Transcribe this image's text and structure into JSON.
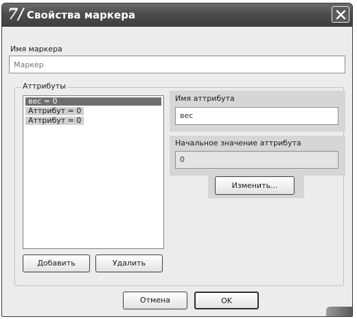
{
  "window": {
    "logo": "7/",
    "title": "Свойства маркера"
  },
  "marker_name": {
    "label": "Имя маркера",
    "placeholder": "Маркер"
  },
  "attributes": {
    "group_label": "Аттрибуты",
    "items": [
      {
        "label": "вес = 0",
        "selected": true
      },
      {
        "label": "Аттрибут = 0",
        "selected": false
      },
      {
        "label": "Аттрибут = 0",
        "selected": false
      }
    ],
    "add_label": "Добавить",
    "delete_label": "Удалить"
  },
  "attribute_name": {
    "label": "Имя аттрибута",
    "value": "вес"
  },
  "initial_value": {
    "label": "Начальное значение аттрибута",
    "value": "0"
  },
  "change_label": "Изменить...",
  "footer": {
    "cancel_label": "Отмена",
    "ok_label": "OK"
  }
}
